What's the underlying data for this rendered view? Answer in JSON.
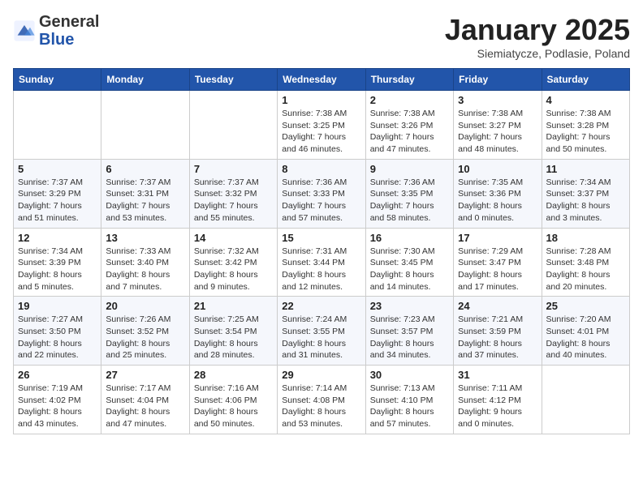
{
  "header": {
    "logo_general": "General",
    "logo_blue": "Blue",
    "month_title": "January 2025",
    "location": "Siemiatycze, Podlasie, Poland"
  },
  "days_of_week": [
    "Sunday",
    "Monday",
    "Tuesday",
    "Wednesday",
    "Thursday",
    "Friday",
    "Saturday"
  ],
  "weeks": [
    [
      {
        "day": "",
        "info": ""
      },
      {
        "day": "",
        "info": ""
      },
      {
        "day": "",
        "info": ""
      },
      {
        "day": "1",
        "info": "Sunrise: 7:38 AM\nSunset: 3:25 PM\nDaylight: 7 hours and 46 minutes."
      },
      {
        "day": "2",
        "info": "Sunrise: 7:38 AM\nSunset: 3:26 PM\nDaylight: 7 hours and 47 minutes."
      },
      {
        "day": "3",
        "info": "Sunrise: 7:38 AM\nSunset: 3:27 PM\nDaylight: 7 hours and 48 minutes."
      },
      {
        "day": "4",
        "info": "Sunrise: 7:38 AM\nSunset: 3:28 PM\nDaylight: 7 hours and 50 minutes."
      }
    ],
    [
      {
        "day": "5",
        "info": "Sunrise: 7:37 AM\nSunset: 3:29 PM\nDaylight: 7 hours and 51 minutes."
      },
      {
        "day": "6",
        "info": "Sunrise: 7:37 AM\nSunset: 3:31 PM\nDaylight: 7 hours and 53 minutes."
      },
      {
        "day": "7",
        "info": "Sunrise: 7:37 AM\nSunset: 3:32 PM\nDaylight: 7 hours and 55 minutes."
      },
      {
        "day": "8",
        "info": "Sunrise: 7:36 AM\nSunset: 3:33 PM\nDaylight: 7 hours and 57 minutes."
      },
      {
        "day": "9",
        "info": "Sunrise: 7:36 AM\nSunset: 3:35 PM\nDaylight: 7 hours and 58 minutes."
      },
      {
        "day": "10",
        "info": "Sunrise: 7:35 AM\nSunset: 3:36 PM\nDaylight: 8 hours and 0 minutes."
      },
      {
        "day": "11",
        "info": "Sunrise: 7:34 AM\nSunset: 3:37 PM\nDaylight: 8 hours and 3 minutes."
      }
    ],
    [
      {
        "day": "12",
        "info": "Sunrise: 7:34 AM\nSunset: 3:39 PM\nDaylight: 8 hours and 5 minutes."
      },
      {
        "day": "13",
        "info": "Sunrise: 7:33 AM\nSunset: 3:40 PM\nDaylight: 8 hours and 7 minutes."
      },
      {
        "day": "14",
        "info": "Sunrise: 7:32 AM\nSunset: 3:42 PM\nDaylight: 8 hours and 9 minutes."
      },
      {
        "day": "15",
        "info": "Sunrise: 7:31 AM\nSunset: 3:44 PM\nDaylight: 8 hours and 12 minutes."
      },
      {
        "day": "16",
        "info": "Sunrise: 7:30 AM\nSunset: 3:45 PM\nDaylight: 8 hours and 14 minutes."
      },
      {
        "day": "17",
        "info": "Sunrise: 7:29 AM\nSunset: 3:47 PM\nDaylight: 8 hours and 17 minutes."
      },
      {
        "day": "18",
        "info": "Sunrise: 7:28 AM\nSunset: 3:48 PM\nDaylight: 8 hours and 20 minutes."
      }
    ],
    [
      {
        "day": "19",
        "info": "Sunrise: 7:27 AM\nSunset: 3:50 PM\nDaylight: 8 hours and 22 minutes."
      },
      {
        "day": "20",
        "info": "Sunrise: 7:26 AM\nSunset: 3:52 PM\nDaylight: 8 hours and 25 minutes."
      },
      {
        "day": "21",
        "info": "Sunrise: 7:25 AM\nSunset: 3:54 PM\nDaylight: 8 hours and 28 minutes."
      },
      {
        "day": "22",
        "info": "Sunrise: 7:24 AM\nSunset: 3:55 PM\nDaylight: 8 hours and 31 minutes."
      },
      {
        "day": "23",
        "info": "Sunrise: 7:23 AM\nSunset: 3:57 PM\nDaylight: 8 hours and 34 minutes."
      },
      {
        "day": "24",
        "info": "Sunrise: 7:21 AM\nSunset: 3:59 PM\nDaylight: 8 hours and 37 minutes."
      },
      {
        "day": "25",
        "info": "Sunrise: 7:20 AM\nSunset: 4:01 PM\nDaylight: 8 hours and 40 minutes."
      }
    ],
    [
      {
        "day": "26",
        "info": "Sunrise: 7:19 AM\nSunset: 4:02 PM\nDaylight: 8 hours and 43 minutes."
      },
      {
        "day": "27",
        "info": "Sunrise: 7:17 AM\nSunset: 4:04 PM\nDaylight: 8 hours and 47 minutes."
      },
      {
        "day": "28",
        "info": "Sunrise: 7:16 AM\nSunset: 4:06 PM\nDaylight: 8 hours and 50 minutes."
      },
      {
        "day": "29",
        "info": "Sunrise: 7:14 AM\nSunset: 4:08 PM\nDaylight: 8 hours and 53 minutes."
      },
      {
        "day": "30",
        "info": "Sunrise: 7:13 AM\nSunset: 4:10 PM\nDaylight: 8 hours and 57 minutes."
      },
      {
        "day": "31",
        "info": "Sunrise: 7:11 AM\nSunset: 4:12 PM\nDaylight: 9 hours and 0 minutes."
      },
      {
        "day": "",
        "info": ""
      }
    ]
  ]
}
